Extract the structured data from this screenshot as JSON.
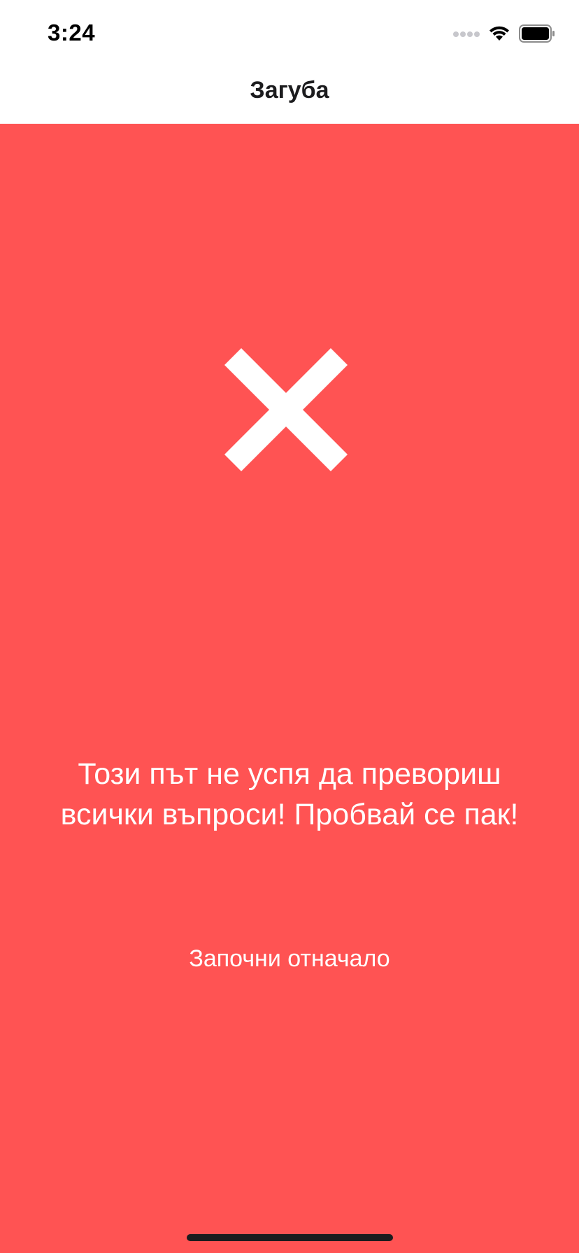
{
  "status_bar": {
    "time": "3:24",
    "icons": [
      "signal-dots-icon",
      "wifi-icon",
      "battery-icon"
    ]
  },
  "nav": {
    "title": "Загуба"
  },
  "result": {
    "icon": "close-x-icon",
    "message": "Този път не успя да превориш всички въпроси! Пробвай се пак!",
    "restart_label": "Започни отначало"
  },
  "colors": {
    "background_fail": "#ff5353",
    "foreground": "#ffffff"
  }
}
